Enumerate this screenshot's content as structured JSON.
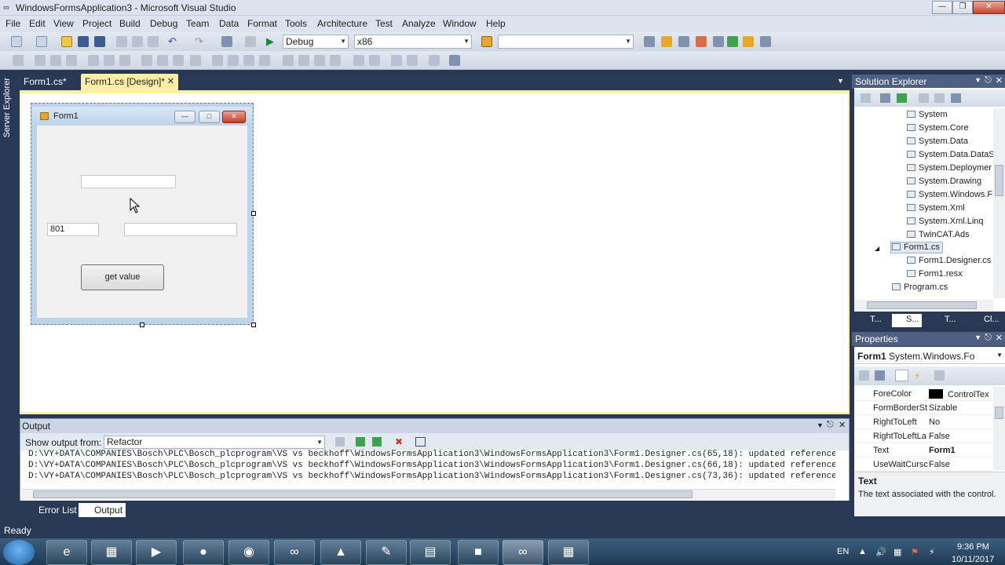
{
  "window": {
    "title": "WindowsFormsApplication3 - Microsoft Visual Studio",
    "min_icon": "minimize-icon",
    "max_icon": "restore-icon",
    "close_icon": "close-icon"
  },
  "menu": [
    "File",
    "Edit",
    "View",
    "Project",
    "Build",
    "Debug",
    "Team",
    "Data",
    "Format",
    "Tools",
    "Architecture",
    "Test",
    "Analyze",
    "Window",
    "Help"
  ],
  "toolbar": {
    "config": "Debug",
    "platform": "x86",
    "search": ""
  },
  "doc_tabs": [
    {
      "label": "Form1.cs*",
      "active": false
    },
    {
      "label": "Form1.cs [Design]*",
      "active": true
    }
  ],
  "side_tab": "Server Explorer",
  "form": {
    "title": "Form1",
    "textbox1": "",
    "textbox2": "801",
    "textbox3": "",
    "button": "get value"
  },
  "output": {
    "title": "Output",
    "show_label": "Show output from:",
    "source": "Refactor",
    "lines": [
      "D:\\VY+DATA\\COMPANIES\\Bosch\\PLC\\Bosch_plcprogram\\VS vs beckhoff\\WindowsFormsApplication3\\WindowsFormsApplication3\\Form1.Designer.cs(65,18): updated reference",
      "D:\\VY+DATA\\COMPANIES\\Bosch\\PLC\\Bosch_plcprogram\\VS vs beckhoff\\WindowsFormsApplication3\\WindowsFormsApplication3\\Form1.Designer.cs(66,18): updated reference",
      "D:\\VY+DATA\\COMPANIES\\Bosch\\PLC\\Bosch_plcprogram\\VS vs beckhoff\\WindowsFormsApplication3\\WindowsFormsApplication3\\Form1.Designer.cs(73,36): updated reference"
    ]
  },
  "bottom_tabs": [
    {
      "label": "Error List",
      "active": false
    },
    {
      "label": "Output",
      "active": true
    }
  ],
  "solution_explorer": {
    "title": "Solution Explorer",
    "items": [
      {
        "label": "System",
        "indent": 2
      },
      {
        "label": "System.Core",
        "indent": 2
      },
      {
        "label": "System.Data",
        "indent": 2
      },
      {
        "label": "System.Data.DataS",
        "indent": 2
      },
      {
        "label": "System.Deploymer",
        "indent": 2
      },
      {
        "label": "System.Drawing",
        "indent": 2
      },
      {
        "label": "System.Windows.F",
        "indent": 2
      },
      {
        "label": "System.Xml",
        "indent": 2
      },
      {
        "label": "System.Xml.Linq",
        "indent": 2
      },
      {
        "label": "TwinCAT.Ads",
        "indent": 2
      },
      {
        "label": "Form1.cs",
        "indent": 1,
        "selected": true
      },
      {
        "label": "Form1.Designer.cs",
        "indent": 2
      },
      {
        "label": "Form1.resx",
        "indent": 2
      },
      {
        "label": "Program.cs",
        "indent": 1
      }
    ],
    "tabs": [
      "T...",
      "S...",
      "T...",
      "Cl..."
    ]
  },
  "properties": {
    "title": "Properties",
    "object_name": "Form1",
    "object_type": "System.Windows.Fo",
    "rows": [
      {
        "name": "ForeColor",
        "value": "ControlTex"
      },
      {
        "name": "FormBorderSt",
        "value": "Sizable"
      },
      {
        "name": "RightToLeft",
        "value": "No"
      },
      {
        "name": "RightToLeftLa",
        "value": "False"
      },
      {
        "name": "Text",
        "value": "Form1"
      },
      {
        "name": "UseWaitCursc",
        "value": "False"
      }
    ],
    "desc_title": "Text",
    "desc_text": "The text associated with the control."
  },
  "status": "Ready",
  "taskbar": {
    "lang": "EN",
    "time": "9:36 PM",
    "date": "10/11/2017",
    "apps": [
      "ie-icon",
      "folder-icon",
      "media-icon",
      "app-icon",
      "chrome-icon",
      "visual-studio-icon",
      "archer-icon",
      "notepad-icon",
      "files-icon",
      "windows-icon",
      "infinity-icon",
      "calculator-icon"
    ]
  },
  "colors": {
    "accent": "#ffeea8",
    "chrome": "#293955",
    "panel_head": "#4d6082"
  }
}
